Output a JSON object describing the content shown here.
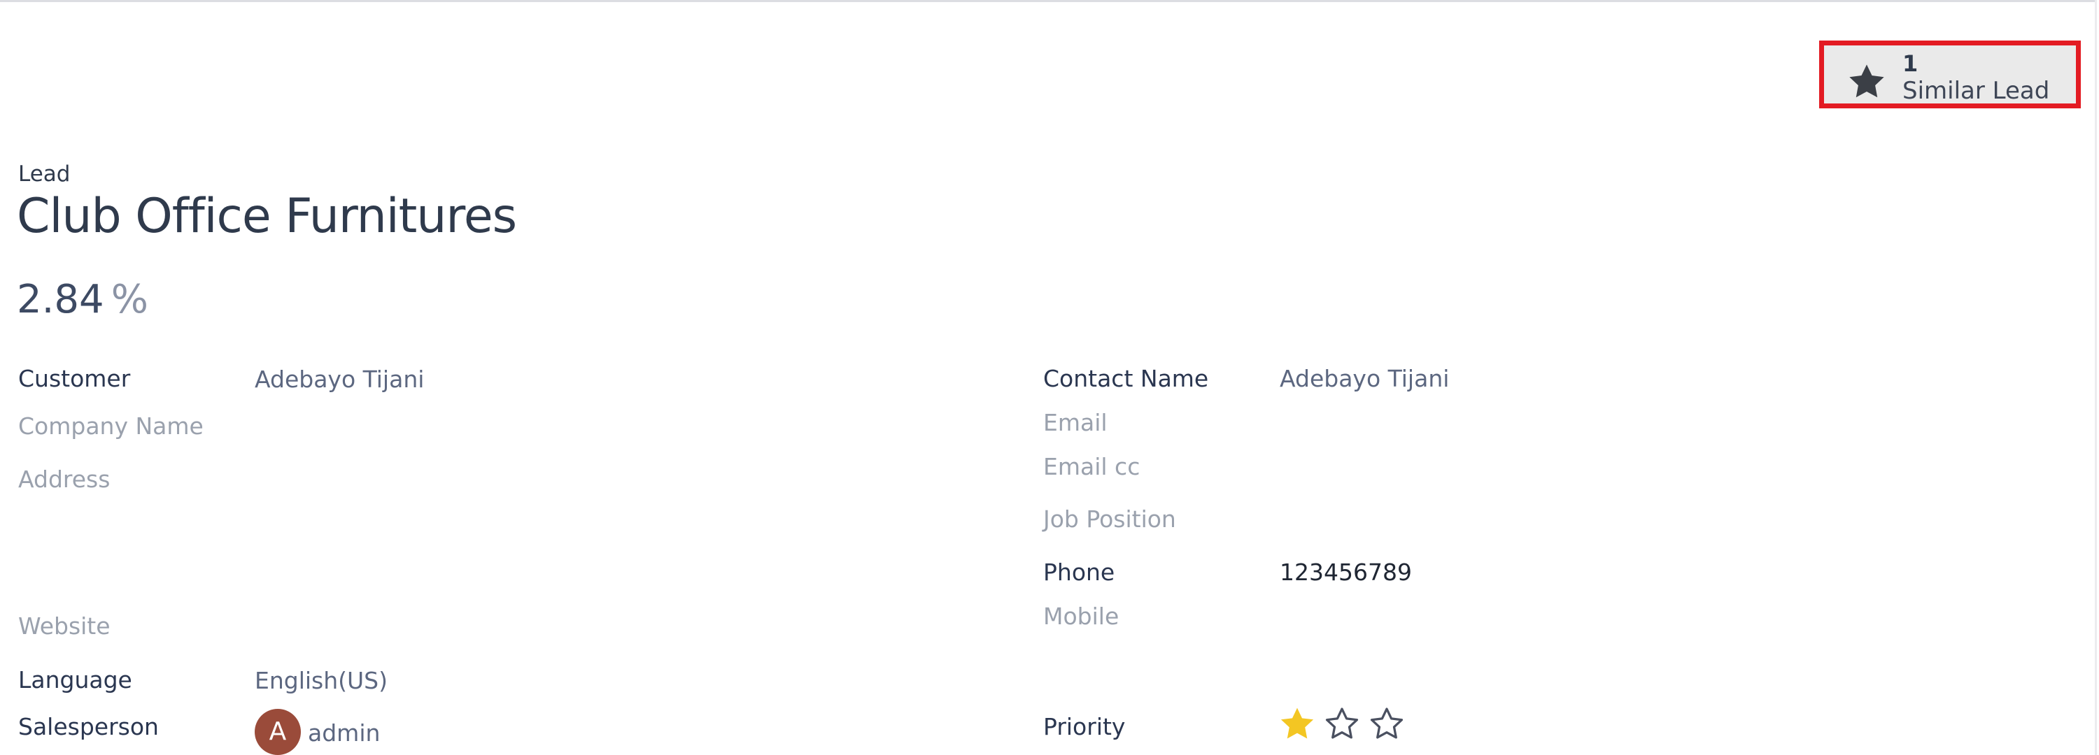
{
  "smart_button": {
    "count": "1",
    "label": "Similar Lead",
    "icon": "star-icon"
  },
  "header": {
    "record_type": "Lead",
    "title": "Club Office Furnitures",
    "probability": "2.84",
    "probability_unit": "%"
  },
  "left_fields": {
    "customer": {
      "label": "Customer",
      "value": "Adebayo Tijani"
    },
    "company_name": {
      "label": "Company Name",
      "value": ""
    },
    "address": {
      "label": "Address",
      "value": ""
    },
    "website": {
      "label": "Website",
      "value": ""
    },
    "language": {
      "label": "Language",
      "value": "English(US)"
    },
    "salesperson": {
      "label": "Salesperson",
      "value": "admin",
      "avatar_initial": "A"
    }
  },
  "right_fields": {
    "contact_name": {
      "label": "Contact Name",
      "value": "Adebayo Tijani"
    },
    "email": {
      "label": "Email",
      "value": ""
    },
    "email_cc": {
      "label": "Email cc",
      "value": ""
    },
    "job_position": {
      "label": "Job Position",
      "value": ""
    },
    "phone": {
      "label": "Phone",
      "value": "123456789"
    },
    "mobile": {
      "label": "Mobile",
      "value": ""
    },
    "priority": {
      "label": "Priority",
      "stars_filled": 1,
      "stars_total": 3
    }
  },
  "colors": {
    "highlight_border": "#e31b23",
    "star_filled": "#f3c623",
    "avatar_bg": "#9a4b3a",
    "text_dark": "#2f3a4c"
  }
}
